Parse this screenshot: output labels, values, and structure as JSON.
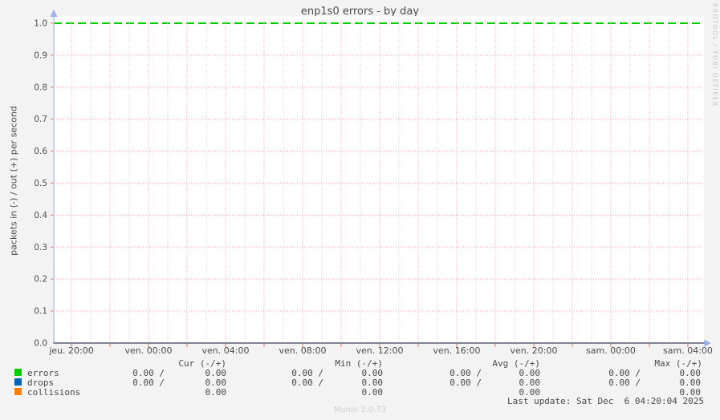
{
  "watermark": "RRDTOOL / TOBI OETIKER",
  "footer": {
    "last_update": "Last update: Sat Dec  6 04:20:04 2025",
    "version": "Munin 2.0.73"
  },
  "colors": {
    "bg": "#f3f3f3",
    "plot_bg": "#ffffff",
    "grid_major": "#ff9d9d",
    "grid_minor": "#c9ccd6",
    "axis_x": "#5b5d73",
    "axis_y": "#bcc5e3",
    "arrow": "#9fb1e4",
    "tick": "#f26d6d",
    "text": "#4d4d4d",
    "errors_green": "#00cc00",
    "drops_blue": "#0066b3",
    "collisions_orange": "#ff8000"
  },
  "chart_data": {
    "type": "line",
    "title": "enp1s0 errors - by day",
    "xlabel": "",
    "ylabel": "packets in (-) / out (+) per second",
    "ylim": [
      0.0,
      1.0
    ],
    "grid": true,
    "y_ticks": [
      0.0,
      0.1,
      0.2,
      0.3,
      0.4,
      0.5,
      0.6,
      0.7,
      0.8,
      0.9,
      1.0
    ],
    "x_tick_labels": [
      "jeu. 20:00",
      "ven. 00:00",
      "ven. 04:00",
      "ven. 08:00",
      "ven. 12:00",
      "ven. 16:00",
      "ven. 20:00",
      "sam. 00:00",
      "sam. 04:00"
    ],
    "x_minor_grid": "hourly dotted, alternating pink (even hours) / gray (odd hours)",
    "series": [
      {
        "name": "errors",
        "color": "#00cc00",
        "style": "dashed-horizontal-line",
        "y": 1.0,
        "note": "flat green dashed line drawn at 1.0; measured values all 0.00"
      },
      {
        "name": "drops",
        "color": "#0066b3",
        "y": null,
        "note": "no visible line, all values 0.00"
      },
      {
        "name": "collisions",
        "color": "#ff8000",
        "y": null,
        "note": "no visible line, all values 0.00"
      }
    ]
  },
  "legend": {
    "columns": [
      "Cur (-/+)",
      "Min (-/+)",
      "Avg (-/+)",
      "Max (-/+)"
    ],
    "rows": [
      {
        "label": "errors",
        "swatch": "#00cc00",
        "cells": [
          "0.00 /",
          "0.00",
          "0.00 /",
          "0.00",
          "0.00 /",
          "0.00",
          "0.00 /",
          "0.00"
        ]
      },
      {
        "label": "drops",
        "swatch": "#0066b3",
        "cells": [
          "0.00 /",
          "0.00",
          "0.00 /",
          "0.00",
          "0.00 /",
          "0.00",
          "0.00 /",
          "0.00"
        ]
      },
      {
        "label": "collisions",
        "swatch": "#ff8000",
        "cells": [
          "",
          "0.00",
          "",
          "0.00",
          "",
          "0.00",
          "",
          "0.00"
        ]
      }
    ]
  }
}
